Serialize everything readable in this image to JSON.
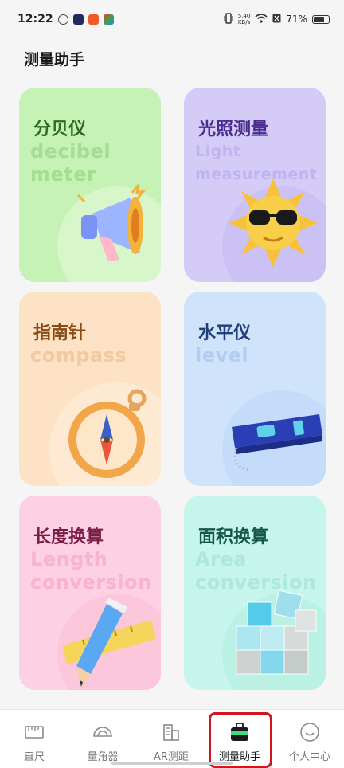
{
  "status_bar": {
    "time": "12:22",
    "net_speed_value": "5.40",
    "net_speed_unit": "KB/s",
    "battery": "71%"
  },
  "page_title": "测量助手",
  "cards": [
    {
      "key": "decibel",
      "title": "分贝仪",
      "subtitle": "decibel\nmeter",
      "bg": "#c6f2b5",
      "title_color": "#2f6b22",
      "sub_color": "#a5dd93",
      "blob": "#e6f9d8"
    },
    {
      "key": "light",
      "title": "光照测量",
      "subtitle": "Light\nmeasurement",
      "bg": "#d4ccf7",
      "title_color": "#4a2c8f",
      "sub_color": "#bfb4f0",
      "blob": "#c2b8f2"
    },
    {
      "key": "compass",
      "title": "指南针",
      "subtitle": "compass",
      "bg": "#fde2c6",
      "title_color": "#8a4a12",
      "sub_color": "#f3c9a2",
      "blob": "#fff0dd"
    },
    {
      "key": "level",
      "title": "水平仪",
      "subtitle": "level",
      "bg": "#cfe3fb",
      "title_color": "#1e3f78",
      "sub_color": "#b3cdf2",
      "blob": "#bcd6f8"
    },
    {
      "key": "length",
      "title": "长度换算",
      "subtitle": "Length\nconversion",
      "bg": "#fdd0e3",
      "title_color": "#7a1c44",
      "sub_color": "#f8b3cf",
      "blob": "#fbbdd6"
    },
    {
      "key": "area",
      "title": "面积换算",
      "subtitle": "Area\nconversion",
      "bg": "#c6f5ec",
      "title_color": "#16574c",
      "sub_color": "#aee8dc",
      "blob": "#b2ecdf"
    }
  ],
  "nav": {
    "items": [
      {
        "label": "直尺",
        "icon": "ruler-icon"
      },
      {
        "label": "量角器",
        "icon": "protractor-icon"
      },
      {
        "label": "AR测距",
        "icon": "ar-distance-icon"
      },
      {
        "label": "测量助手",
        "icon": "toolbox-icon"
      },
      {
        "label": "个人中心",
        "icon": "profile-icon"
      }
    ],
    "active": "测量助手"
  }
}
